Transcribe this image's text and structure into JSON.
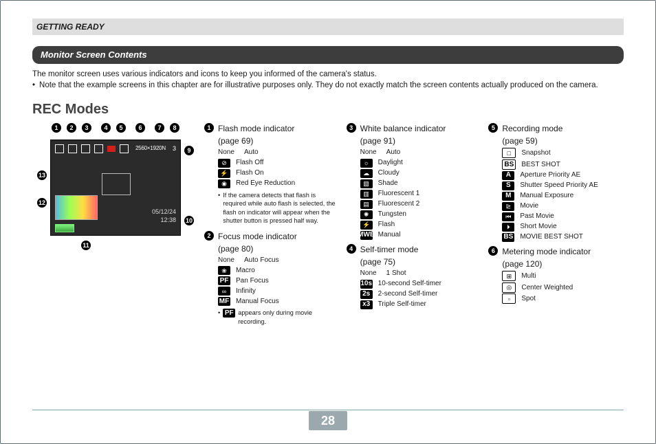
{
  "header": {
    "section": "GETTING READY"
  },
  "subheader": {
    "title": "Monitor Screen Contents"
  },
  "intro": {
    "line1": "The monitor screen uses various indicators and icons to keep you informed of the camera's status.",
    "line2": "Note that the example screens in this chapter are for illustrative purposes only. They do not exactly match the screen contents actually produced on the camera."
  },
  "rec_title": "REC Modes",
  "callout_numbers_top": [
    "1",
    "2",
    "3",
    "4",
    "5",
    "6",
    "7",
    "8"
  ],
  "side_numbers": {
    "n9": "9",
    "n10": "10",
    "n11": "11",
    "n12": "12",
    "n13": "13"
  },
  "screen": {
    "resolution": "2560×1920N",
    "count": "3",
    "date": "05/12/24",
    "time": "12:38"
  },
  "col1": {
    "s1": {
      "num": "1",
      "title": "Flash mode indicator",
      "page": "(page 69)",
      "rows": [
        {
          "key": "None",
          "label": "Auto"
        },
        {
          "icon": "⊘",
          "label": "Flash Off"
        },
        {
          "icon": "⚡",
          "label": "Flash On"
        },
        {
          "icon": "◉",
          "label": "Red Eye Reduction"
        }
      ],
      "note": "If the camera detects that flash is required while auto flash is selected, the flash on indicator will appear when the shutter button is pressed half way."
    },
    "s2": {
      "num": "2",
      "title": "Focus mode indicator",
      "page": "(page 80)",
      "rows": [
        {
          "key": "None",
          "label": "Auto Focus"
        },
        {
          "icon": "❀",
          "label": "Macro"
        },
        {
          "icon": "PF",
          "variant": "letter",
          "label": "Pan Focus"
        },
        {
          "icon": "∞",
          "label": "Infinity"
        },
        {
          "icon": "MF",
          "variant": "letter",
          "label": "Manual Focus"
        }
      ],
      "note_prefix": "PF",
      "note": " appears only during movie recording."
    }
  },
  "col2": {
    "s3": {
      "num": "3",
      "title": "White balance indicator",
      "page": "(page 91)",
      "rows": [
        {
          "key": "None",
          "label": "Auto"
        },
        {
          "icon": "☼",
          "label": "Daylight"
        },
        {
          "icon": "☁",
          "label": "Cloudy"
        },
        {
          "icon": "▧",
          "label": "Shade"
        },
        {
          "icon": "▥",
          "label": "Fluorescent 1"
        },
        {
          "icon": "▤",
          "label": "Fluorescent 2"
        },
        {
          "icon": "✺",
          "label": "Tungsten"
        },
        {
          "icon": "⚡",
          "label": "Flash"
        },
        {
          "icon": "MWB",
          "variant": "letter",
          "label": "Manual"
        }
      ]
    },
    "s4": {
      "num": "4",
      "title": "Self-timer mode",
      "page": "(page 75)",
      "rows": [
        {
          "key": "None",
          "label": "1 Shot"
        },
        {
          "icon": "10s",
          "variant": "letter",
          "label": "10-second Self-timer"
        },
        {
          "icon": "2s",
          "variant": "letter",
          "label": "2-second Self-timer"
        },
        {
          "icon": "x3",
          "variant": "letter",
          "label": "Triple Self-timer"
        }
      ]
    }
  },
  "col3": {
    "s5": {
      "num": "5",
      "title": "Recording mode",
      "page": "(page 59)",
      "rows": [
        {
          "icon": "□",
          "variant": "outline",
          "label": "Snapshot"
        },
        {
          "icon": "BS",
          "variant": "outline letter",
          "label": "BEST SHOT"
        },
        {
          "icon": "A",
          "variant": "letter",
          "label": "Aperture Priority AE"
        },
        {
          "icon": "S",
          "variant": "letter",
          "label": "Shutter Speed Priority AE"
        },
        {
          "icon": "M",
          "variant": "letter",
          "label": "Manual Exposure"
        },
        {
          "icon": "⊵",
          "label": "Movie"
        },
        {
          "icon": "⏮",
          "label": "Past Movie"
        },
        {
          "icon": "⏵",
          "label": "Short Movie"
        },
        {
          "icon": "BS",
          "variant": "letter",
          "label": "MOVIE BEST SHOT"
        }
      ]
    },
    "s6": {
      "num": "6",
      "title": "Metering mode indicator",
      "page": "(page 120)",
      "rows": [
        {
          "icon": "⊞",
          "variant": "outline",
          "label": "Multi"
        },
        {
          "icon": "◎",
          "variant": "outline",
          "label": "Center Weighted"
        },
        {
          "icon": "▫",
          "variant": "outline",
          "label": "Spot"
        }
      ]
    }
  },
  "footer": {
    "page_number": "28"
  }
}
